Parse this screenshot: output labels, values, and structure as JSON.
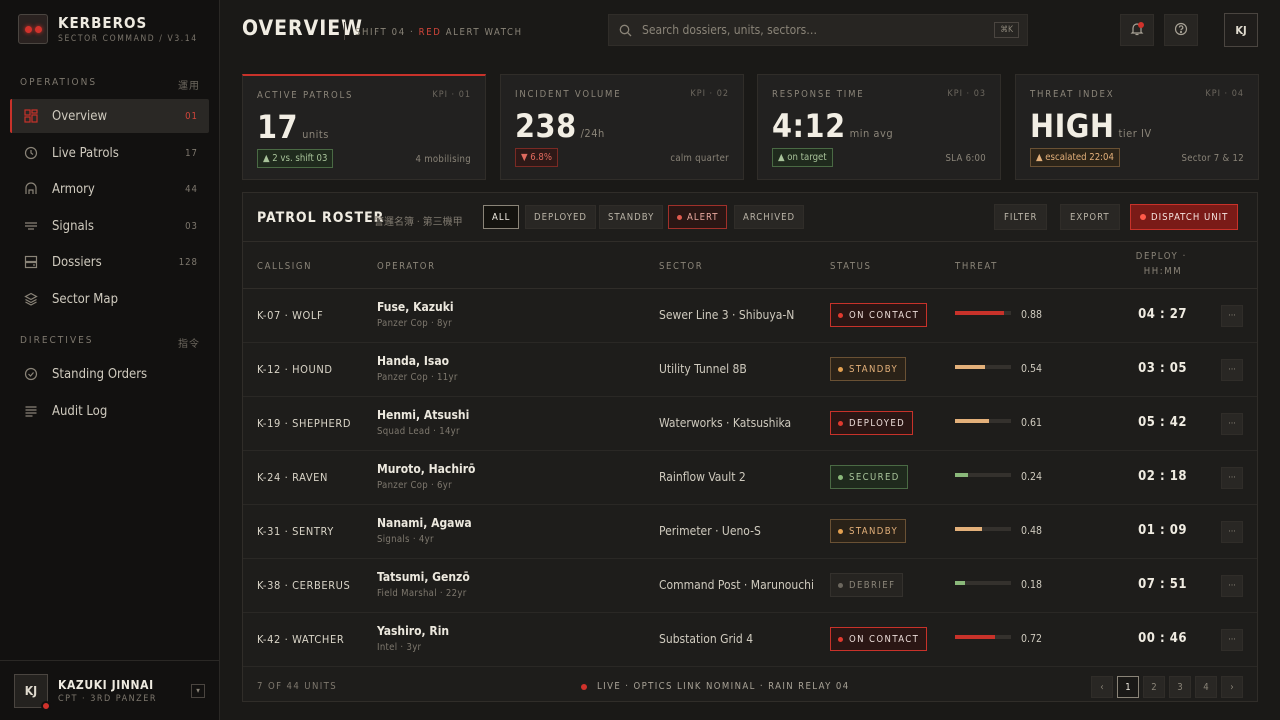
{
  "brand": {
    "name": "KERBEROS",
    "subtitle": "SECTOR COMMAND  /  V3.14"
  },
  "sidebar": {
    "operations_label": "OPERATIONS",
    "operations_jp": "運用",
    "items": [
      {
        "label": "Overview",
        "count": "01",
        "icon": "grid-icon"
      },
      {
        "label": "Live Patrols",
        "count": "17",
        "icon": "clock-icon"
      },
      {
        "label": "Armory",
        "count": "44",
        "icon": "armory-icon"
      },
      {
        "label": "Signals",
        "count": "03",
        "icon": "signal-icon"
      },
      {
        "label": "Dossiers",
        "count": "128",
        "icon": "dossier-icon"
      },
      {
        "label": "Sector Map",
        "count": "",
        "icon": "layers-icon"
      }
    ],
    "directives_label": "DIRECTIVES",
    "directives_jp": "指令",
    "directive_items": [
      {
        "label": "Standing Orders",
        "icon": "check-circle-icon"
      },
      {
        "label": "Audit Log",
        "icon": "list-icon"
      }
    ],
    "user": {
      "initials": "KJ",
      "name": "KAZUKI JINNAI",
      "role": "CPT · 3RD PANZER"
    }
  },
  "header": {
    "title": "OVERVIEW",
    "shift_prefix": "SHIFT 04 · ",
    "shift_red": "RED",
    "shift_suffix": " ALERT WATCH",
    "search_placeholder": "Search dossiers, units, sectors…",
    "search_shortcut": "⌘K",
    "user_initials": "KJ"
  },
  "kpis": [
    {
      "label": "ACTIVE PATROLS",
      "id": "KPI · 01",
      "value": "17",
      "unit": "units",
      "tag": "▲ 2 vs. shift 03",
      "tag_style": "green",
      "note": "4 mobilising"
    },
    {
      "label": "INCIDENT VOLUME",
      "id": "KPI · 02",
      "value": "238",
      "unit": "/24h",
      "tag": "▼ 6.8%",
      "tag_style": "red",
      "note": "calm quarter"
    },
    {
      "label": "RESPONSE TIME",
      "id": "KPI · 03",
      "value": "4:12",
      "unit": "min avg",
      "tag": "▲ on target",
      "tag_style": "green",
      "note": "SLA 6:00"
    },
    {
      "label": "THREAT INDEX",
      "id": "KPI · 04",
      "value": "HIGH",
      "unit": "tier IV",
      "tag": "▲ escalated 22:04",
      "tag_style": "amber",
      "note": "Sector 7 & 12"
    }
  ],
  "roster": {
    "title": "PATROL ROSTER",
    "title_jp": "警邏名簿 · 第三機甲",
    "filters": [
      "ALL",
      "DEPLOYED",
      "STANDBY",
      "ALERT",
      "ARCHIVED"
    ],
    "active_filter": "ALL",
    "actions": {
      "filter": "FILTER",
      "export": "EXPORT",
      "dispatch": "DISPATCH UNIT"
    },
    "columns": {
      "callsign": "CALLSIGN",
      "operator": "OPERATOR",
      "sector": "SECTOR",
      "status": "STATUS",
      "threat": "THREAT",
      "deploy_1": "DEPLOY ·",
      "deploy_2": "HH:MM"
    },
    "rows": [
      {
        "callsign": "K-07 · WOLF",
        "name": "Fuse, Kazuki",
        "sub": "Panzer Cop · 8yr",
        "sector": "Sewer Line 3 · Shibuya-N",
        "status": "ON CONTACT",
        "status_style": "contact",
        "threat": 0.88,
        "threat_label": "0.88",
        "time": "04 : 27"
      },
      {
        "callsign": "K-12 · HOUND",
        "name": "Handa, Isao",
        "sub": "Panzer Cop · 11yr",
        "sector": "Utility Tunnel 8B",
        "status": "STANDBY",
        "status_style": "standby",
        "threat": 0.54,
        "threat_label": "0.54",
        "time": "03 : 05"
      },
      {
        "callsign": "K-19 · SHEPHERD",
        "name": "Henmi, Atsushi",
        "sub": "Squad Lead · 14yr",
        "sector": "Waterworks · Katsushika",
        "status": "DEPLOYED",
        "status_style": "deployed",
        "threat": 0.61,
        "threat_label": "0.61",
        "time": "05 : 42"
      },
      {
        "callsign": "K-24 · RAVEN",
        "name": "Muroto, Hachirō",
        "sub": "Panzer Cop · 6yr",
        "sector": "Rainflow Vault 2",
        "status": "SECURED",
        "status_style": "secured",
        "threat": 0.24,
        "threat_label": "0.24",
        "time": "02 : 18"
      },
      {
        "callsign": "K-31 · SENTRY",
        "name": "Nanami, Agawa",
        "sub": "Signals · 4yr",
        "sector": "Perimeter · Ueno-S",
        "status": "STANDBY",
        "status_style": "standby",
        "threat": 0.48,
        "threat_label": "0.48",
        "time": "01 : 09"
      },
      {
        "callsign": "K-38 · CERBERUS",
        "name": "Tatsumi, Genzō",
        "sub": "Field Marshal · 22yr",
        "sector": "Command Post · Marunouchi",
        "status": "DEBRIEF",
        "status_style": "debrief",
        "threat": 0.18,
        "threat_label": "0.18",
        "time": "07 : 51"
      },
      {
        "callsign": "K-42 · WATCHER",
        "name": "Yashiro, Rin",
        "sub": "Intel · 3yr",
        "sector": "Substation Grid 4",
        "status": "ON CONTACT",
        "status_style": "contact",
        "threat": 0.72,
        "threat_label": "0.72",
        "time": "00 : 46"
      }
    ],
    "footer_count": "7 OF 44 UNITS",
    "live_status": "LIVE · OPTICS LINK NOMINAL · RAIN RELAY 04",
    "pagination": {
      "prev": "‹",
      "pages": [
        "1",
        "2",
        "3",
        "4"
      ],
      "current": "1",
      "next": "›"
    }
  },
  "colors": {
    "accent": "#c8322a",
    "threat_high": "#c8322a",
    "threat_mid": "#e3b07a",
    "threat_low": "#8ab87a"
  }
}
